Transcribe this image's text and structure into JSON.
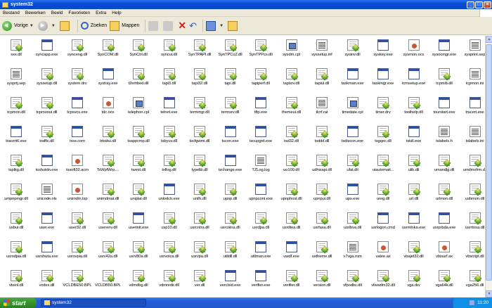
{
  "window": {
    "title": "system32"
  },
  "menu": [
    "Bestand",
    "Bewerken",
    "Beeld",
    "Favorieten",
    "Extra",
    "Help"
  ],
  "toolbar": {
    "back_label": "Vorige",
    "search_label": "Zoeken",
    "folders_label": "Mappen"
  },
  "files": [
    [
      "sxs.dll",
      "syncapp.exe",
      "synceng.dll",
      "SynCOM.dll",
      "SynCtrl.dll",
      "syncui.dll",
      "SynTPAPI.dll",
      "SynTPCo2.dll",
      "SynTPPcs.dll",
      "sysdm.cpl",
      "syssetup.inf",
      "sysinv.dll",
      "syskey.exe",
      "sysmon.ocx",
      "sysocmgr.exe",
      "sysprint.sep"
    ],
    [
      "sysprtj.sep",
      "syssetup.dll",
      "system.drv",
      "systray.exe",
      "t2embed.dll",
      "tapi3.dll",
      "tapi32.dll",
      "tapi.dll",
      "tapiperf.dll",
      "tapisrv.dll",
      "tapiui.dll",
      "taskman.exe",
      "taskmgr.exe",
      "tcmsetup.exe",
      "tcpmib.dll",
      "tcpmon.ini"
    ],
    [
      "tcpmon.dll",
      "tcpmonui.dll",
      "tcpsvcs.exe",
      "tdc.ocx",
      "telephon.cpl",
      "telnet.exe",
      "termmgr.dll",
      "termsrv.dll",
      "tftp.exe",
      "themeui.dll",
      "tlcrf.rat",
      "timedate.cpl",
      "timer.drv",
      "toolhelp.dll",
      "tourstart.exe",
      "tracert.exe"
    ],
    [
      "tracert6.exe",
      "traffic.dll",
      "tree.com",
      "trkwks.dll",
      "tsappcmp.dll",
      "tsbyuv.dll",
      "tscfgwmi.dll",
      "tscon.exe",
      "tscupgrd.exe",
      "tsd32.dll",
      "tsddd.dll",
      "tsdiscon.exe",
      "tsgqec.dll",
      "tskill.exe",
      "tslabels.h",
      "tslabels.ini"
    ],
    [
      "tsplkg.dll",
      "tsshutdn.exe",
      "tssoft32.acm",
      "TsWpfWrp....",
      "twext.dll",
      "txflog.dll",
      "typelib.dll",
      "tzchange.exe",
      "TZLog.log",
      "uo100.dll",
      "udhisapi.dll",
      "ufat.dll",
      "uiautomati...",
      "ulib.dll",
      "umandlg.dll",
      "umdmxfrm.dll"
    ],
    [
      "umpnpmgr.dll",
      "unicode.nls",
      "unimdm.tsp",
      "unimdmat.dll",
      "uniplat.dll",
      "unlodctr.exe",
      "untfs.dll",
      "upnp.dll",
      "upnpcont.exe",
      "upnphost.dll",
      "upnpui.dll",
      "ups.exe",
      "ureg.dll",
      "url.dll",
      "urlmon.dll",
      "usbmon.dll"
    ],
    [
      "usbui.dll",
      "user.exe",
      "user32.dll",
      "userenv.dll",
      "userinit.exe",
      "usp10.dll",
      "usrcntra.dll",
      "usrcoina.dll",
      "usrdpa.dll",
      "usrdtea.dll",
      "usrfaxa.dll",
      "usrlbva.dll",
      "usrlogon.cmd",
      "usrmlnka.exe",
      "usrprbda.exe",
      "usrrtosa.dll"
    ],
    [
      "usrsdpia.dll",
      "usrshuta.exe",
      "usrsvpia.dll",
      "usrv42a.dll",
      "usrv80a.dll",
      "usrvoica.dll",
      "usrvpa.dll",
      "utildll.dll",
      "utilman.exe",
      "uwdf.exe",
      "uxtheme.dll",
      "v7vga.rom",
      "vatee.ax",
      "vbajet32.dll",
      "vbisurf.ax",
      "vbscript.dll"
    ],
    [
      "vbsnl.dll",
      "vcdex.dll",
      "VCLDBE50.BPL",
      "VCLDB50.BPL",
      "vdmdbg.dll",
      "vdmredir.dll",
      "ver.dll",
      "verclsid.exe",
      "verifier.exe",
      "verifier.dll",
      "version.dll",
      "vfpodbc.dll",
      "vfwwdm32.dll",
      "vga.drv",
      "vga64k.dll",
      "vga256.dll"
    ]
  ],
  "taskbar": {
    "start_label": "start",
    "task_label": "system32",
    "clock": "11:20"
  }
}
